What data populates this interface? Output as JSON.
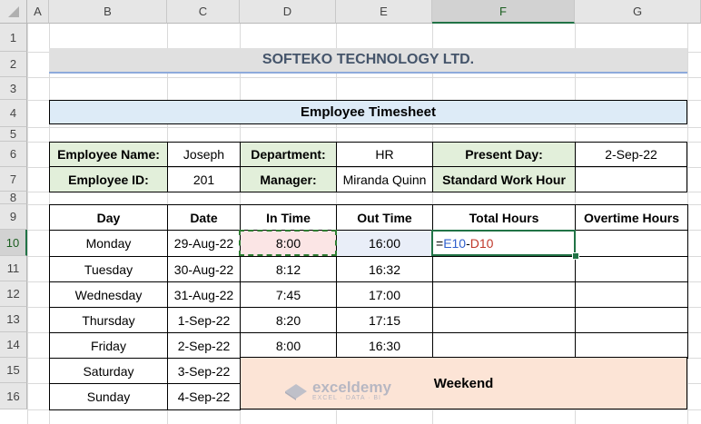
{
  "columns": [
    "A",
    "B",
    "C",
    "D",
    "E",
    "F",
    "G"
  ],
  "rows": [
    "1",
    "2",
    "3",
    "4",
    "5",
    "6",
    "7",
    "8",
    "9",
    "10",
    "11",
    "12",
    "13",
    "14",
    "15",
    "16"
  ],
  "selected_column": "F",
  "selected_row": "10",
  "company": "SOFTEKO TECHNOLOGY LTD.",
  "subtitle": "Employee Timesheet",
  "info": {
    "employee_name_label": "Employee Name:",
    "employee_name": "Joseph",
    "department_label": "Department:",
    "department": "HR",
    "present_day_label": "Present Day:",
    "present_day": "2-Sep-22",
    "employee_id_label": "Employee ID:",
    "employee_id": "201",
    "manager_label": "Manager:",
    "manager": "Miranda Quinn",
    "standard_work_hour_label": "Standard Work Hour",
    "standard_work_hour": ""
  },
  "table": {
    "headers": [
      "Day",
      "Date",
      "In Time",
      "Out Time",
      "Total Hours",
      "Overtime Hours"
    ],
    "rows": [
      {
        "day": "Monday",
        "date": "29-Aug-22",
        "in": "8:00",
        "out": "16:00"
      },
      {
        "day": "Tuesday",
        "date": "30-Aug-22",
        "in": "8:12",
        "out": "16:32"
      },
      {
        "day": "Wednesday",
        "date": "31-Aug-22",
        "in": "7:45",
        "out": "17:00"
      },
      {
        "day": "Thursday",
        "date": "1-Sep-22",
        "in": "8:20",
        "out": "17:15"
      },
      {
        "day": "Friday",
        "date": "2-Sep-22",
        "in": "8:00",
        "out": "16:30"
      },
      {
        "day": "Saturday",
        "date": "3-Sep-22"
      },
      {
        "day": "Sunday",
        "date": "4-Sep-22"
      }
    ],
    "weekend_label": "Weekend"
  },
  "formula": {
    "eq": "=",
    "ref1": "E10",
    "op": "-",
    "ref2": "D10"
  },
  "watermark": {
    "brand": "exceldemy",
    "tagline": "EXCEL · DATA · BI"
  },
  "colors": {
    "label_fill": "#e2efda",
    "subtitle_fill": "#ddebf7",
    "weekend_fill": "#fce4d6",
    "selection": "#217346"
  }
}
